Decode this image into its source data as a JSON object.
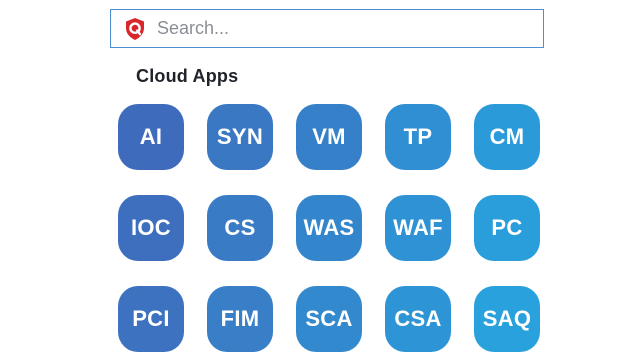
{
  "search": {
    "placeholder": "Search...",
    "logo_icon": "qualys-shield-icon",
    "logo_color": "#d9262c",
    "border_color": "#4a8fd0"
  },
  "section": {
    "title": "Cloud Apps"
  },
  "apps": [
    {
      "label": "AI",
      "color": "#3f6bbd"
    },
    {
      "label": "SYN",
      "color": "#3b78c3"
    },
    {
      "label": "VM",
      "color": "#3580c8"
    },
    {
      "label": "TP",
      "color": "#2f8fd2"
    },
    {
      "label": "CM",
      "color": "#2b9ad9"
    },
    {
      "label": "IOC",
      "color": "#3e6fbf"
    },
    {
      "label": "CS",
      "color": "#3a7bc5"
    },
    {
      "label": "WAS",
      "color": "#3486cc"
    },
    {
      "label": "WAF",
      "color": "#2e92d4"
    },
    {
      "label": "PC",
      "color": "#2a9edb"
    },
    {
      "label": "PCI",
      "color": "#3d72c1"
    },
    {
      "label": "FIM",
      "color": "#387fc7"
    },
    {
      "label": "SCA",
      "color": "#3289ce"
    },
    {
      "label": "CSA",
      "color": "#2d95d6"
    },
    {
      "label": "SAQ",
      "color": "#29a1dc"
    }
  ]
}
